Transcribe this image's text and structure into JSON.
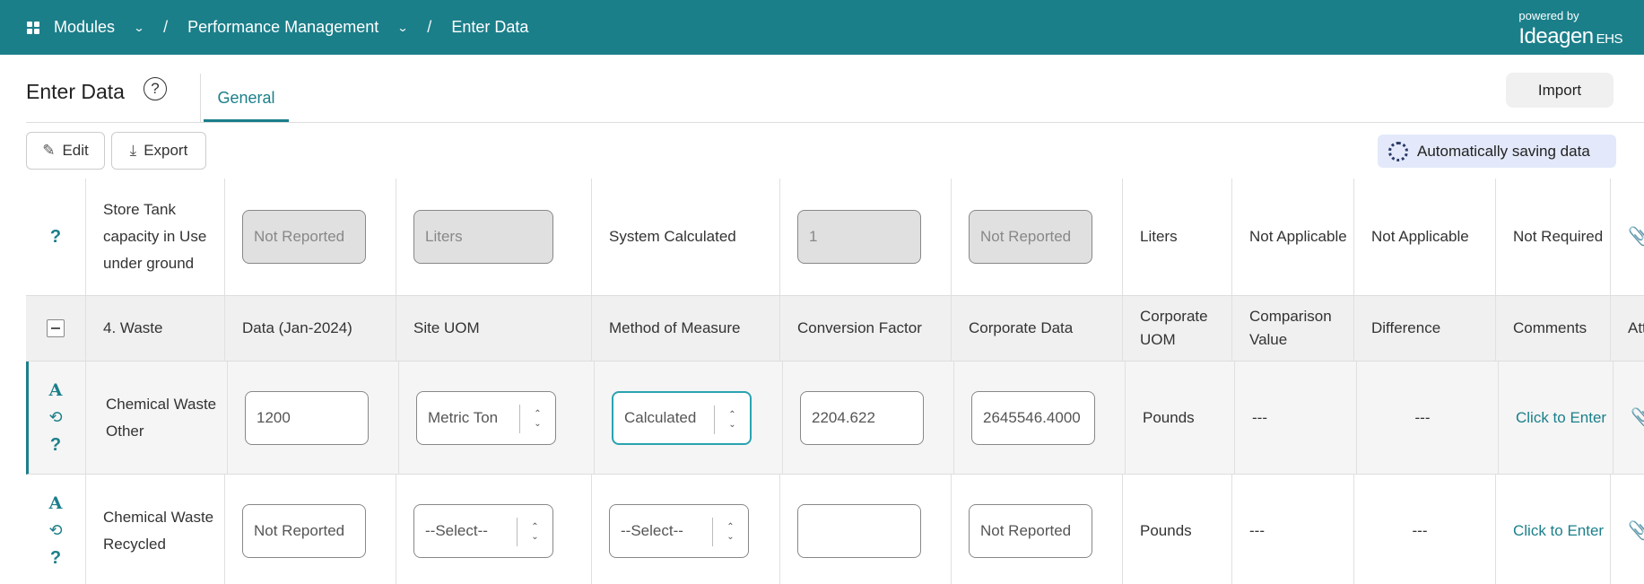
{
  "topbar": {
    "breadcrumb": [
      "Modules",
      "Performance Management",
      "Enter Data"
    ],
    "separator": "/",
    "powered_by": "powered by",
    "brand": "Ideagen",
    "brand_suffix": "EHS"
  },
  "header": {
    "title": "Enter Data",
    "help": "?",
    "tab": "General",
    "import_label": "Import"
  },
  "toolbar": {
    "edit_label": "Edit",
    "export_label": "Export",
    "saving_label": "Automatically saving data"
  },
  "table": {
    "top_row": {
      "name": "Store Tank capacity in Use under ground",
      "data": "Not Reported",
      "site_uom": "Liters",
      "method": "System Calculated",
      "conversion": "1",
      "corporate_data": "Not Reported",
      "corporate_uom": "Liters",
      "comparison": "Not Applicable",
      "difference": "Not Applicable",
      "comments": "Not Required"
    },
    "headers": {
      "category": "4. Waste",
      "data": "Data (Jan-2024)",
      "site_uom": "Site UOM",
      "method": "Method of Measure",
      "conversion": "Conversion Factor",
      "corporate_data": "Corporate Data",
      "corporate_uom": "Corporate UOM",
      "comparison": "Comparison Value",
      "difference": "Difference",
      "comments": "Comments",
      "attach": "Att"
    },
    "rows": [
      {
        "name": "Chemical Waste Other",
        "data": "1200",
        "site_uom": "Metric Ton",
        "method": "Calculated",
        "conversion": "2204.622",
        "corporate_data": "2645546.4000",
        "corporate_uom": "Pounds",
        "comparison": "---",
        "difference": "---",
        "comments": "Click to Enter"
      },
      {
        "name": "Chemical Waste Recycled",
        "data_placeholder": "Not Reported",
        "site_uom": "--Select--",
        "method": "--Select--",
        "conversion": "",
        "corporate_data": "Not Reported",
        "corporate_uom": "Pounds",
        "comparison": "---",
        "difference": "---",
        "comments": "Click to Enter"
      }
    ],
    "icons": {
      "a": "A",
      "help": "?"
    }
  },
  "colors": {
    "brand": "#1b7f8a",
    "saving_bg": "#e3e9fa"
  }
}
